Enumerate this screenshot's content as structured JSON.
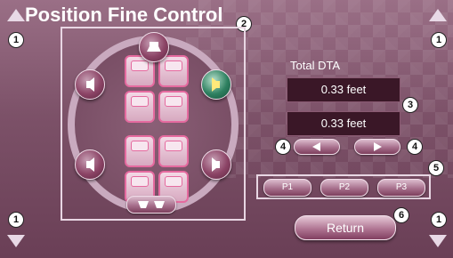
{
  "title": "Position Fine Control",
  "total_dta_label": "Total DTA",
  "values": {
    "top": "0.33 feet",
    "bottom": "0.33 feet"
  },
  "buttons": {
    "p1": "P1",
    "p2": "P2",
    "p3": "P3",
    "return": "Return"
  },
  "callouts": {
    "c1": "1",
    "c2": "2",
    "c3": "3",
    "c4": "4",
    "c5": "5",
    "c6": "6"
  },
  "icons": {
    "corner_up": "up-arrow-icon",
    "corner_down": "down-arrow-icon",
    "speaker": "speaker-icon",
    "left_arrow": "left-arrow-icon",
    "right_arrow": "right-arrow-icon",
    "front_speaker": "front-speaker-icon",
    "sub_speaker": "subwoofer-icon"
  },
  "colors": {
    "background": "#7c5168",
    "active_green": "#2e8060",
    "seat_pink": "#e56a9f"
  }
}
